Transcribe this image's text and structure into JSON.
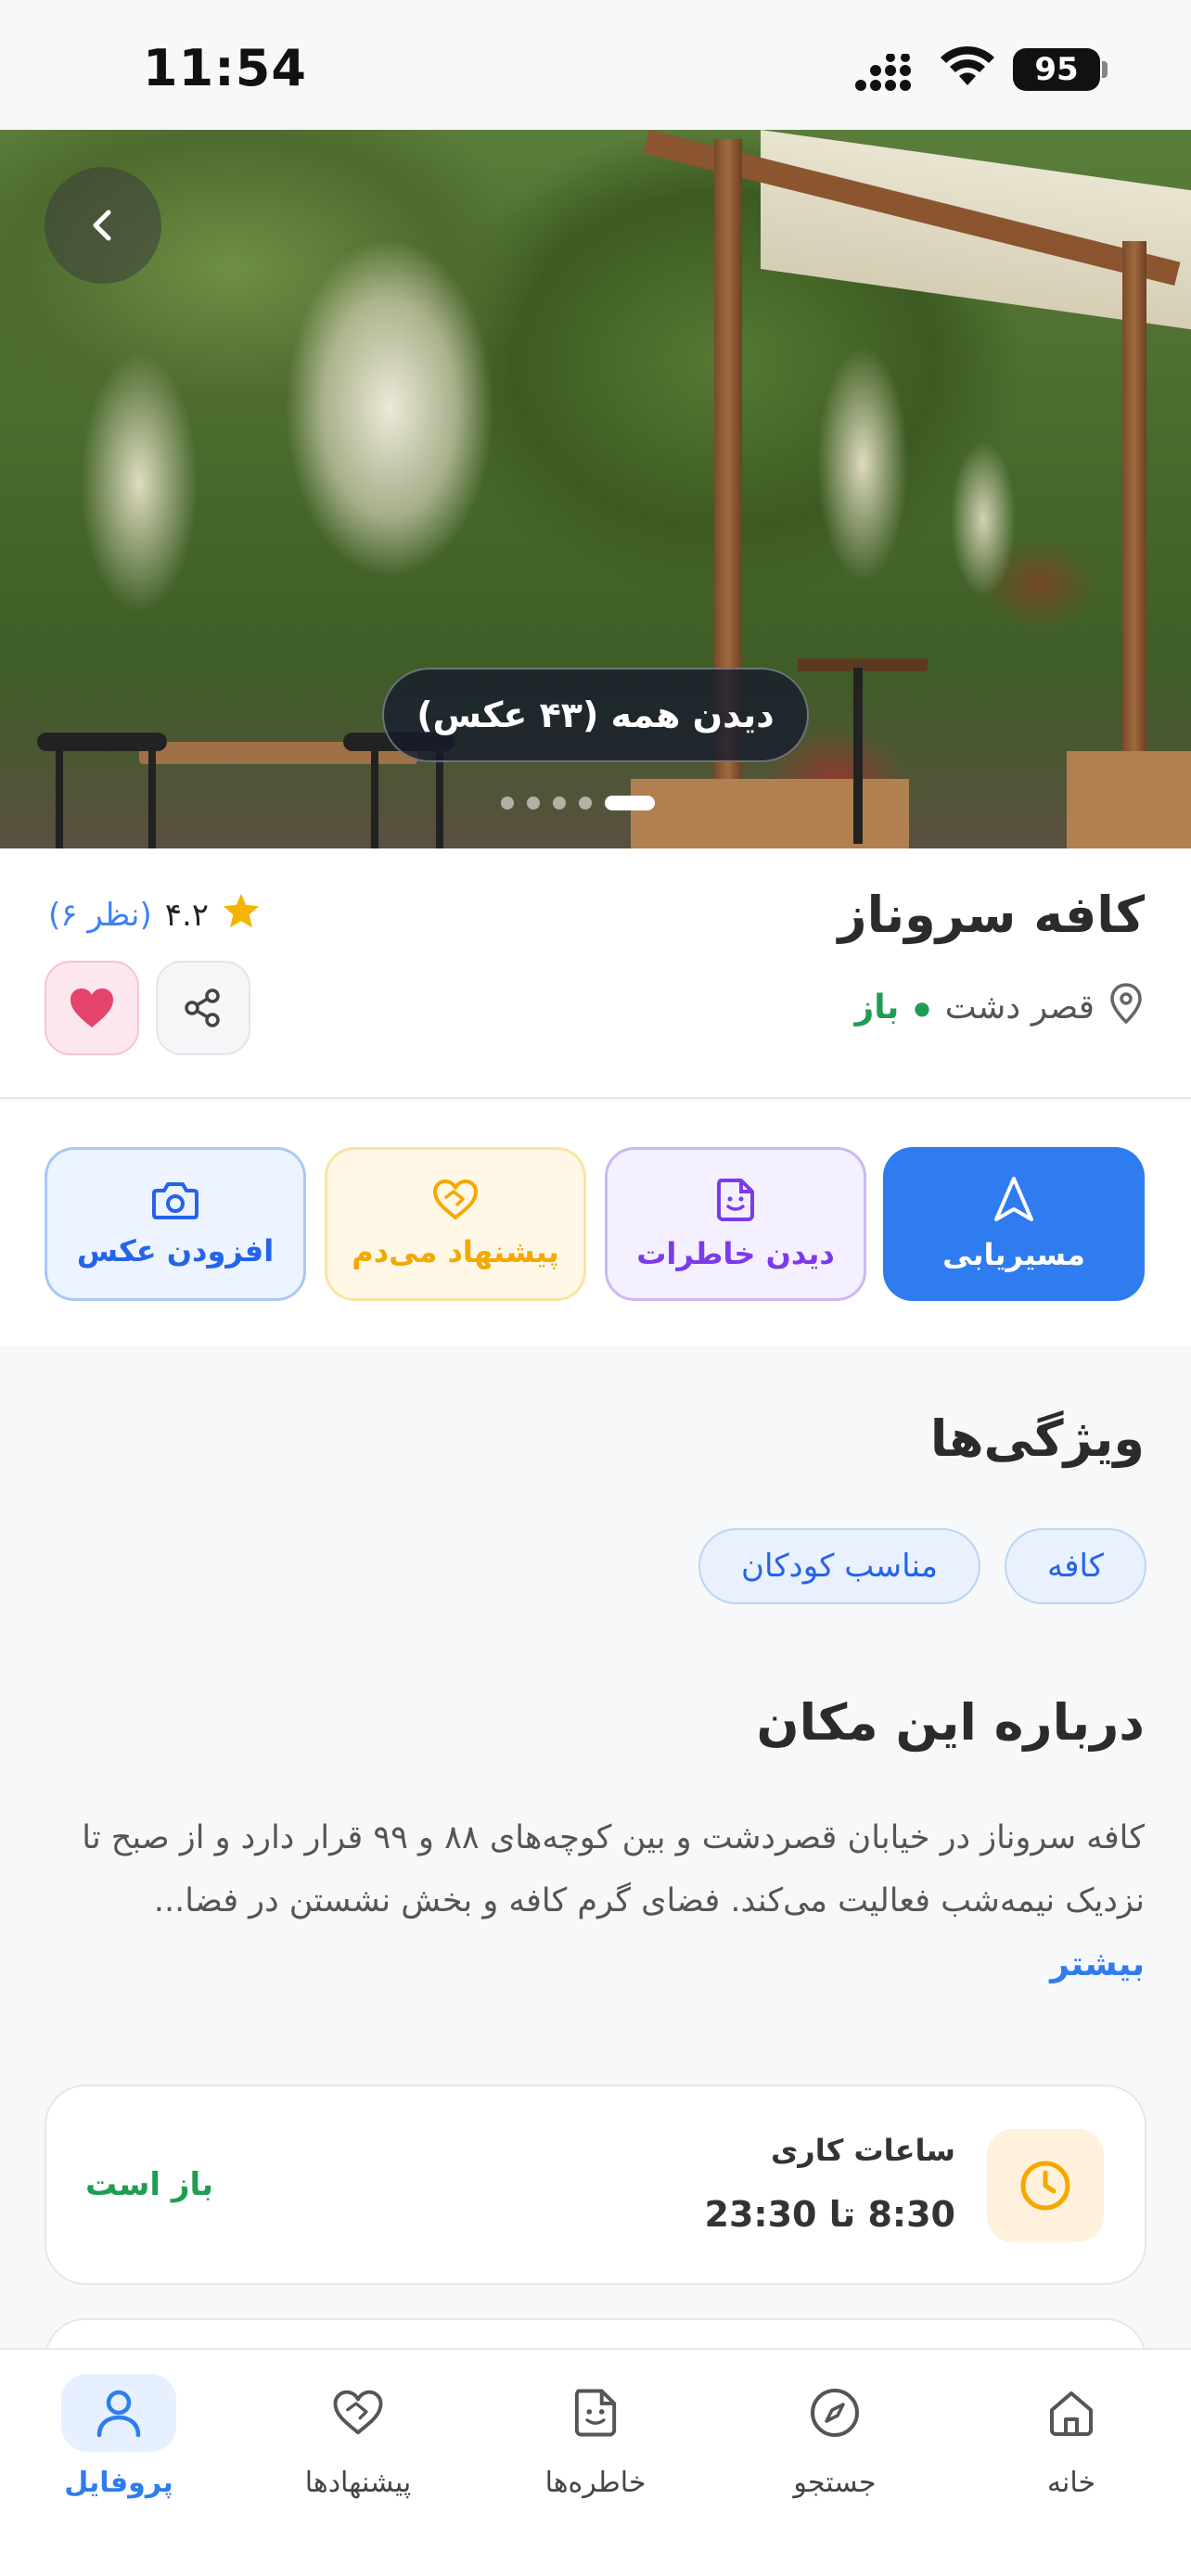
{
  "status_bar": {
    "time": "11:54",
    "battery": "95"
  },
  "hero": {
    "see_all_label": "دیدن همه (۴۳ عکس)",
    "dots_count": 5,
    "active_dot": 4
  },
  "place": {
    "name": "کافه سروناز",
    "location": "قصر دشت",
    "status": "باز",
    "rating": "۴.۲",
    "reviews": "(۶ نظر)"
  },
  "actions": {
    "route": "مسیریابی",
    "memories": "دیدن خاطرات",
    "suggest": "پیشنهاد می‌دم",
    "add_photo": "افزودن عکس"
  },
  "features": {
    "title": "ویژگی‌ها",
    "tags": [
      "کافه",
      "مناسب کودکان"
    ]
  },
  "about": {
    "title": "درباره این مکان",
    "text": "کافه سروناز در خیابان قصردشت و بین کوچه‌های ۸۸ و ۹۹ قرار دارد و از صبح تا نزدیک نیمه‌شب فعالیت می‌کند. فضای گرم کافه و بخش نشستن در فضا...",
    "more": "بیشتر"
  },
  "hours": {
    "label": "ساعات کاری",
    "value": "8:30 تا 23:30",
    "status": "باز است"
  },
  "nav": {
    "home": "خانه",
    "search": "جستجو",
    "memories": "خاطره‌ها",
    "suggestions": "پیشنهادها",
    "profile": "پروفایل"
  },
  "colors": {
    "primary": "#2f7cf0",
    "open_green": "#1f9d55",
    "star": "#f5b400",
    "heart": "#e5446d"
  }
}
